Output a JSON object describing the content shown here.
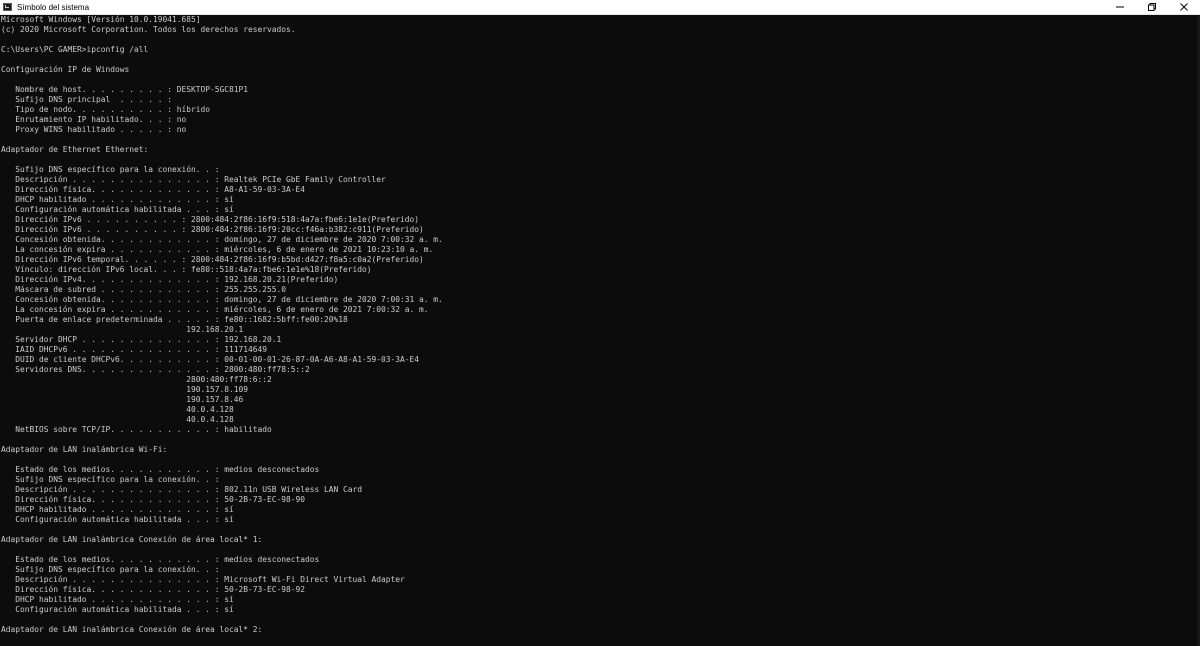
{
  "window": {
    "title": "Símbolo del sistema",
    "icon": "cmd-icon",
    "controls": [
      "minimize-icon",
      "restore-icon",
      "close-icon"
    ]
  },
  "colors": {
    "background": "#0c0c0c",
    "text": "#cccccc",
    "titlebar": "#ffffff"
  },
  "console": {
    "lines": [
      "Microsoft Windows [Versión 10.0.19041.685]",
      "(c) 2020 Microsoft Corporation. Todos los derechos reservados.",
      "",
      "C:\\Users\\PC GAMER>ipconfig /all",
      "",
      "Configuración IP de Windows",
      "",
      "   Nombre de host. . . . . . . . . : DESKTOP-5GC81P1",
      "   Sufijo DNS principal  . . . . . :",
      "   Tipo de nodo. . . . . . . . . . : híbrido",
      "   Enrutamiento IP habilitado. . . : no",
      "   Proxy WINS habilitado . . . . . : no",
      "",
      "Adaptador de Ethernet Ethernet:",
      "",
      "   Sufijo DNS específico para la conexión. . :",
      "   Descripción . . . . . . . . . . . . . . . : Realtek PCIe GbE Family Controller",
      "   Dirección física. . . . . . . . . . . . . : A8-A1-59-03-3A-E4",
      "   DHCP habilitado . . . . . . . . . . . . . : sí",
      "   Configuración automática habilitada . . . : sí",
      "   Dirección IPv6 . . . . . . . . . . : 2800:484:2f86:16f9:518:4a7a:fbe6:1e1e(Preferido)",
      "   Dirección IPv6 . . . . . . . . . . : 2800:484:2f86:16f9:20cc:f46a:b382:c911(Preferido)",
      "   Concesión obtenida. . . . . . . . . . . . : domingo, 27 de diciembre de 2020 7:00:32 a. m.",
      "   La concesión expira . . . . . . . . . . . : miércoles, 6 de enero de 2021 10:23:10 a. m.",
      "   Dirección IPv6 temporal. . . . . . : 2800:484:2f86:16f9:b5bd:d427:f8a5:c0a2(Preferido)",
      "   Vínculo: dirección IPv6 local. . . : fe80::518:4a7a:fbe6:1e1e%18(Preferido)",
      "   Dirección IPv4. . . . . . . . . . . . . . : 192.168.20.21(Preferido)",
      "   Máscara de subred . . . . . . . . . . . . : 255.255.255.0",
      "   Concesión obtenida. . . . . . . . . . . . : domingo, 27 de diciembre de 2020 7:00:31 a. m.",
      "   La concesión expira . . . . . . . . . . . : miércoles, 6 de enero de 2021 7:00:32 a. m.",
      "   Puerta de enlace predeterminada . . . . . : fe80::1682:5bff:fe00:20%18",
      "                                       192.168.20.1",
      "   Servidor DHCP . . . . . . . . . . . . . . : 192.168.20.1",
      "   IAID DHCPv6 . . . . . . . . . . . . . . . : 111714649",
      "   DUID de cliente DHCPv6. . . . . . . . . . : 00-01-00-01-26-87-0A-A6-A8-A1-59-03-3A-E4",
      "   Servidores DNS. . . . . . . . . . . . . . : 2800:480:ff78:5::2",
      "                                       2800:480:ff78:6::2",
      "                                       190.157.8.109",
      "                                       190.157.8.46",
      "                                       40.0.4.128",
      "                                       40.0.4.128",
      "   NetBIOS sobre TCP/IP. . . . . . . . . . . : habilitado",
      "",
      "Adaptador de LAN inalámbrica Wi-Fi:",
      "",
      "   Estado de los medios. . . . . . . . . . . : medios desconectados",
      "   Sufijo DNS específico para la conexión. . :",
      "   Descripción . . . . . . . . . . . . . . . : 802.11n USB Wireless LAN Card",
      "   Dirección física. . . . . . . . . . . . . : 50-2B-73-EC-98-90",
      "   DHCP habilitado . . . . . . . . . . . . . : sí",
      "   Configuración automática habilitada . . . : sí",
      "",
      "Adaptador de LAN inalámbrica Conexión de área local* 1:",
      "",
      "   Estado de los medios. . . . . . . . . . . : medios desconectados",
      "   Sufijo DNS específico para la conexión. . :",
      "   Descripción . . . . . . . . . . . . . . . : Microsoft Wi-Fi Direct Virtual Adapter",
      "   Dirección física. . . . . . . . . . . . . : 50-2B-73-EC-98-92",
      "   DHCP habilitado . . . . . . . . . . . . . : sí",
      "   Configuración automática habilitada . . . : sí",
      "",
      "Adaptador de LAN inalámbrica Conexión de área local* 2:",
      ""
    ]
  }
}
